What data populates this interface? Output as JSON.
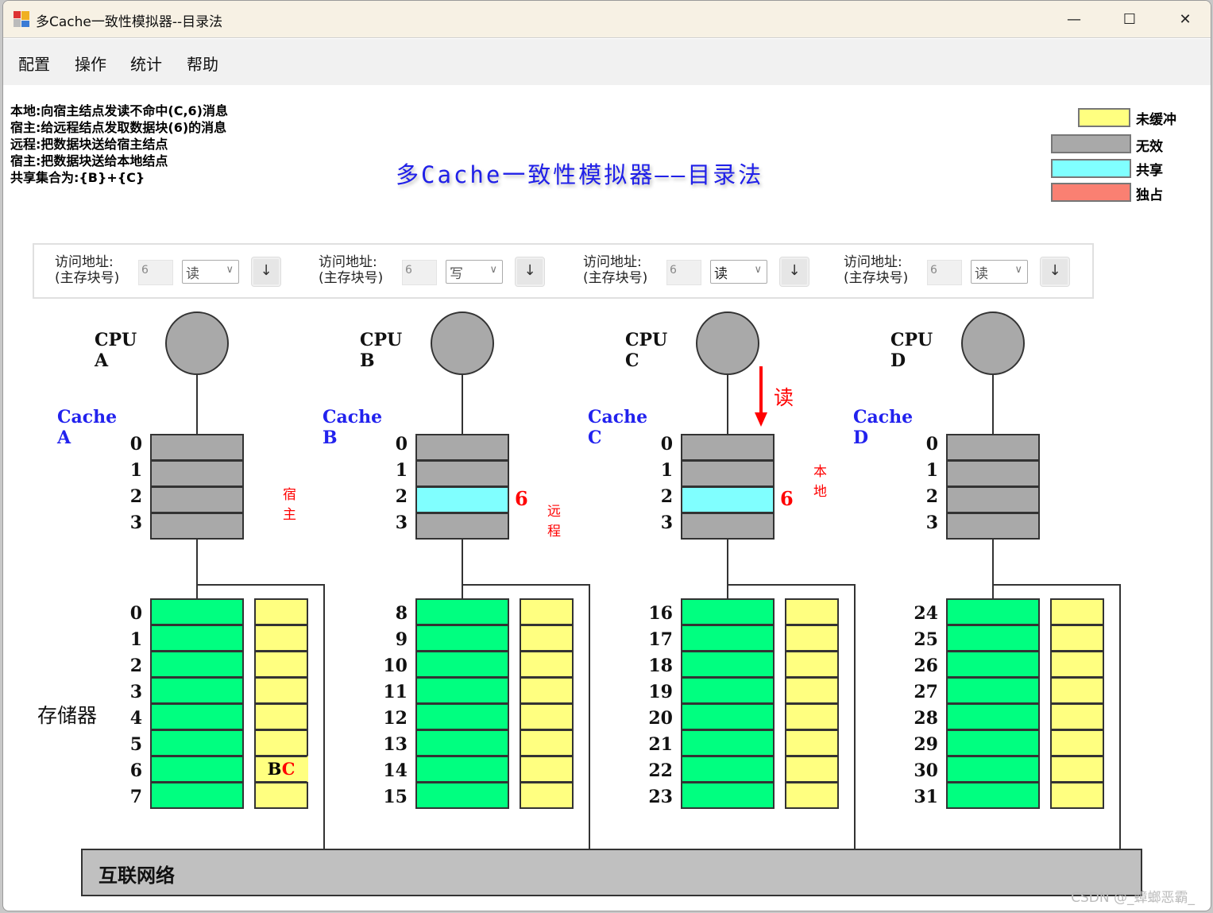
{
  "window": {
    "title": "多Cache一致性模拟器--目录法",
    "controls": {
      "minimize": "—",
      "maximize": "☐",
      "close": "✕"
    }
  },
  "menu": [
    "配置",
    "操作",
    "统计",
    "帮助"
  ],
  "messages": [
    "本地:向宿主结点发读不命中(C,6)消息",
    "宿主:给远程结点发取数据块(6)的消息",
    "远程:把数据块送给宿主结点",
    "宿主:把数据块送给本地结点",
    "共享集合为:{B}+{C}"
  ],
  "main_title": "多Cache一致性模拟器——目录法",
  "legend": [
    {
      "label": "未缓冲",
      "color": "#ffff80"
    },
    {
      "label": "无效",
      "color": "#a9a9a9"
    },
    {
      "label": "共享",
      "color": "#80ffff"
    },
    {
      "label": "独占",
      "color": "#fa8072"
    }
  ],
  "controls": {
    "label_line1": "访问地址:",
    "label_line2": "(主存块号)",
    "button_icon": "↓",
    "chevron": "∨",
    "processors": [
      {
        "addr": "6",
        "op": "读"
      },
      {
        "addr": "6",
        "op": "写"
      },
      {
        "addr": "6",
        "op": "读"
      },
      {
        "addr": "6",
        "op": "读"
      }
    ]
  },
  "nodes": [
    {
      "cpu": "CPU  A",
      "cache": "Cache  A",
      "lines": [
        {
          "state": "invalid",
          "block": ""
        },
        {
          "state": "invalid",
          "block": ""
        },
        {
          "state": "invalid",
          "block": ""
        },
        {
          "state": "invalid",
          "block": ""
        }
      ],
      "role": "宿主",
      "mem_start": 0,
      "directory": {
        "6": [
          "B",
          "C"
        ]
      }
    },
    {
      "cpu": "CPU  B",
      "cache": "Cache  B",
      "lines": [
        {
          "state": "invalid",
          "block": ""
        },
        {
          "state": "invalid",
          "block": ""
        },
        {
          "state": "shared",
          "block": "6"
        },
        {
          "state": "invalid",
          "block": ""
        }
      ],
      "role": "远程",
      "mem_start": 8,
      "directory": {}
    },
    {
      "cpu": "CPU  C",
      "cache": "Cache  C",
      "lines": [
        {
          "state": "invalid",
          "block": ""
        },
        {
          "state": "invalid",
          "block": ""
        },
        {
          "state": "shared",
          "block": "6"
        },
        {
          "state": "invalid",
          "block": ""
        }
      ],
      "role": "本地",
      "mem_start": 16,
      "directory": {},
      "access_arrow": "读"
    },
    {
      "cpu": "CPU  D",
      "cache": "Cache  D",
      "lines": [
        {
          "state": "invalid",
          "block": ""
        },
        {
          "state": "invalid",
          "block": ""
        },
        {
          "state": "invalid",
          "block": ""
        },
        {
          "state": "invalid",
          "block": ""
        }
      ],
      "role": "",
      "mem_start": 24,
      "directory": {}
    }
  ],
  "colors": {
    "invalid": "#a9a9a9",
    "shared": "#80ffff",
    "exclusive": "#fa8072",
    "memory": "#00ff80",
    "directory": "#ffff80",
    "cpu": "#a9a9a9"
  },
  "memory_label": "存储器",
  "bus_label": "互联网络",
  "watermark": "CSDN @_蟑螂恶霸_"
}
